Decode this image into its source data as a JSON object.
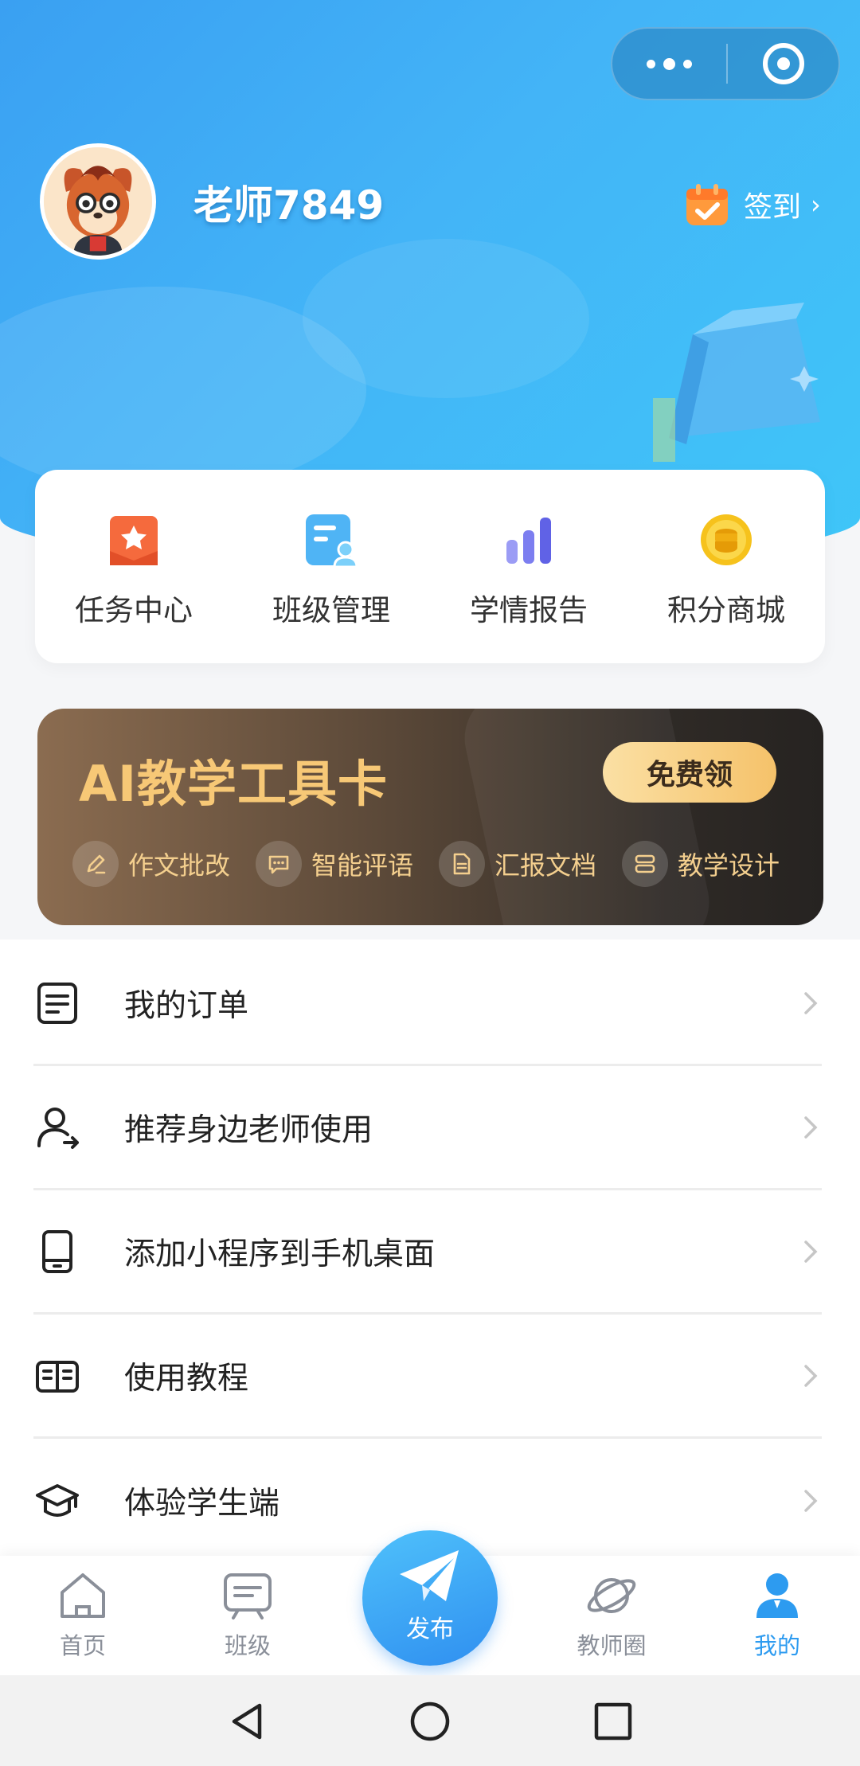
{
  "header": {
    "username": "老师7849",
    "checkin_label": "签到",
    "checkin_arrow": "›"
  },
  "quick_actions": [
    {
      "label": "任务中心",
      "icon": "task-star-icon",
      "color": "#f56a3d"
    },
    {
      "label": "班级管理",
      "icon": "class-manage-icon",
      "color": "#4fb4f5"
    },
    {
      "label": "学情报告",
      "icon": "bar-chart-icon",
      "color": "#7c7ef0"
    },
    {
      "label": "积分商城",
      "icon": "coin-icon",
      "color": "#f6c21c"
    }
  ],
  "ai_card": {
    "title": "AI教学工具卡",
    "button": "免费领",
    "tools": [
      {
        "label": "作文批改",
        "icon": "pen-icon"
      },
      {
        "label": "智能评语",
        "icon": "comment-icon"
      },
      {
        "label": "汇报文档",
        "icon": "document-icon"
      },
      {
        "label": "教学设计",
        "icon": "design-icon"
      }
    ]
  },
  "menu": [
    {
      "label": "我的订单",
      "icon": "order-icon"
    },
    {
      "label": "推荐身边老师使用",
      "icon": "recommend-user-icon"
    },
    {
      "label": "添加小程序到手机桌面",
      "icon": "phone-icon"
    },
    {
      "label": "使用教程",
      "icon": "book-icon"
    },
    {
      "label": "体验学生端",
      "icon": "graduation-cap-icon"
    }
  ],
  "tabbar": {
    "home": "首页",
    "class": "班级",
    "publish": "发布",
    "circle": "教师圈",
    "mine": "我的",
    "active_color": "#2d9bf0"
  }
}
